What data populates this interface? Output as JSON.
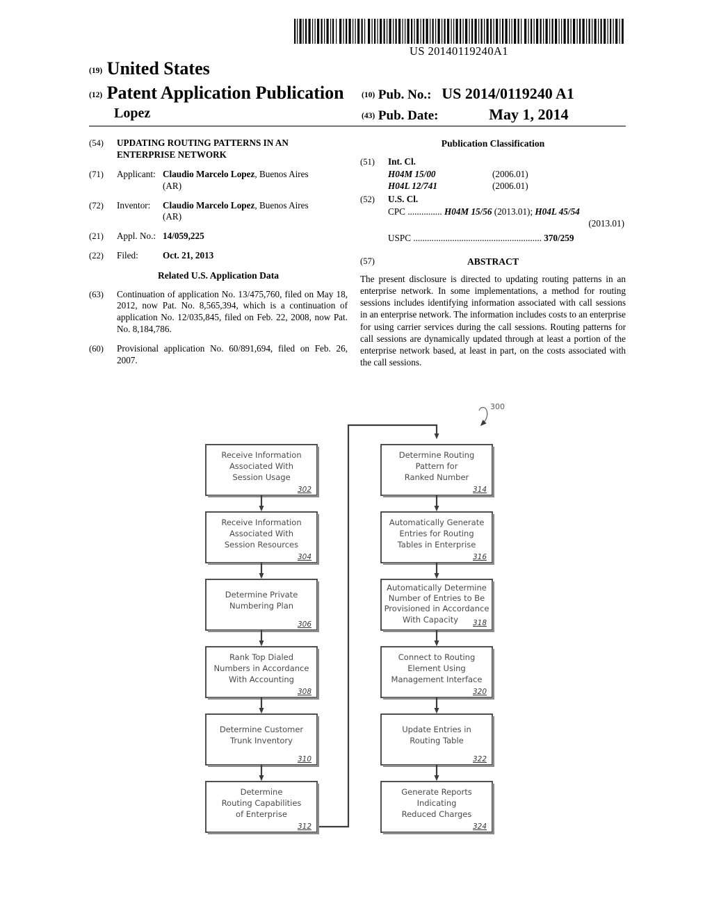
{
  "barcode": {
    "number_text": "US 20140119240A1",
    "icon": "barcode-icon"
  },
  "masthead": {
    "code_19": "(19)",
    "country": "United States",
    "code_12": "(12)",
    "doc_type": "Patent Application Publication",
    "author": "Lopez",
    "code_10": "(10)",
    "pub_no_label": "Pub. No.:",
    "pub_no_value": "US 2014/0119240 A1",
    "code_43": "(43)",
    "pub_date_label": "Pub. Date:",
    "pub_date_value": "May 1, 2014"
  },
  "left_column": {
    "title": {
      "code": "(54)",
      "text": "UPDATING ROUTING PATTERNS IN AN ENTERPRISE NETWORK"
    },
    "applicant": {
      "code": "(71)",
      "label": "Applicant:",
      "name": "Claudio Marcelo Lopez",
      "rest": ", Buenos Aires",
      "line2": "(AR)"
    },
    "inventor": {
      "code": "(72)",
      "label": "Inventor:",
      "name": "Claudio Marcelo Lopez",
      "rest": ", Buenos Aires",
      "line2": "(AR)"
    },
    "appl_no": {
      "code": "(21)",
      "label": "Appl. No.:",
      "value": "14/059,225"
    },
    "filed": {
      "code": "(22)",
      "label": "Filed:",
      "value": "Oct. 21, 2013"
    },
    "related_head": "Related U.S. Application Data",
    "continuation": {
      "code": "(63)",
      "text": "Continuation of application No. 13/475,760, filed on May 18, 2012, now Pat. No. 8,565,394, which is a continuation of application No. 12/035,845, filed on Feb. 22, 2008, now Pat. No. 8,184,786."
    },
    "provisional": {
      "code": "(60)",
      "text": "Provisional application No. 60/891,694, filed on Feb. 26, 2007."
    }
  },
  "right_column": {
    "classification_head": "Publication Classification",
    "int_cl": {
      "code": "(51)",
      "label": "Int. Cl.",
      "entries": [
        {
          "symbol": "H04M 15/00",
          "edition": "(2006.01)"
        },
        {
          "symbol": "H04L 12/741",
          "edition": "(2006.01)"
        }
      ]
    },
    "us_cl": {
      "code": "(52)",
      "label": "U.S. Cl.",
      "cpc_label": "CPC",
      "cpc_dots": "...............",
      "cpc_value_1": "H04M 15/56",
      "cpc_edition_1": "(2013.01);",
      "cpc_value_2": "H04L 45/54",
      "cpc_edition_2": "(2013.01)",
      "uspc_label": "USPC",
      "uspc_dots": "........................................................",
      "uspc_value": "370/259"
    },
    "abstract": {
      "code": "(57)",
      "title": "ABSTRACT",
      "text": "The present disclosure is directed to updating routing patterns in an enterprise network. In some implementations, a method for routing sessions includes identifying information associated with call sessions in an enterprise network. The information includes costs to an enterprise for using carrier services during the call sessions. Routing patterns for call sessions are dynamically updated through at least a portion of the enterprise network based, at least in part, on the costs associated with the call sessions."
    }
  },
  "figure": {
    "figure_ref": "300",
    "boxes": [
      {
        "ref": "302",
        "lines": [
          "Receive Information",
          "Associated With",
          "Session Usage"
        ]
      },
      {
        "ref": "304",
        "lines": [
          "Receive Information",
          "Associated With",
          "Session Resources"
        ]
      },
      {
        "ref": "306",
        "lines": [
          "Determine Private",
          "Numbering Plan"
        ]
      },
      {
        "ref": "308",
        "lines": [
          "Rank Top Dialed",
          "Numbers in Accordance",
          "With Accounting"
        ]
      },
      {
        "ref": "310",
        "lines": [
          "Determine Customer",
          "Trunk Inventory"
        ]
      },
      {
        "ref": "312",
        "lines": [
          "Determine",
          "Routing Capabilities",
          "of Enterprise"
        ]
      },
      {
        "ref": "314",
        "lines": [
          "Determine Routing",
          "Pattern for",
          "Ranked Number"
        ]
      },
      {
        "ref": "316",
        "lines": [
          "Automatically Generate",
          "Entries for Routing",
          "Tables in Enterprise"
        ]
      },
      {
        "ref": "318",
        "lines": [
          "Automatically Determine",
          "Number of Entries to Be",
          "Provisioned in Accordance",
          "With Capacity"
        ]
      },
      {
        "ref": "320",
        "lines": [
          "Connect to Routing",
          "Element Using",
          "Management Interface"
        ]
      },
      {
        "ref": "322",
        "lines": [
          "Update Entries in",
          "Routing Table"
        ]
      },
      {
        "ref": "324",
        "lines": [
          "Generate Reports",
          "Indicating",
          "Reduced Charges"
        ]
      }
    ]
  }
}
